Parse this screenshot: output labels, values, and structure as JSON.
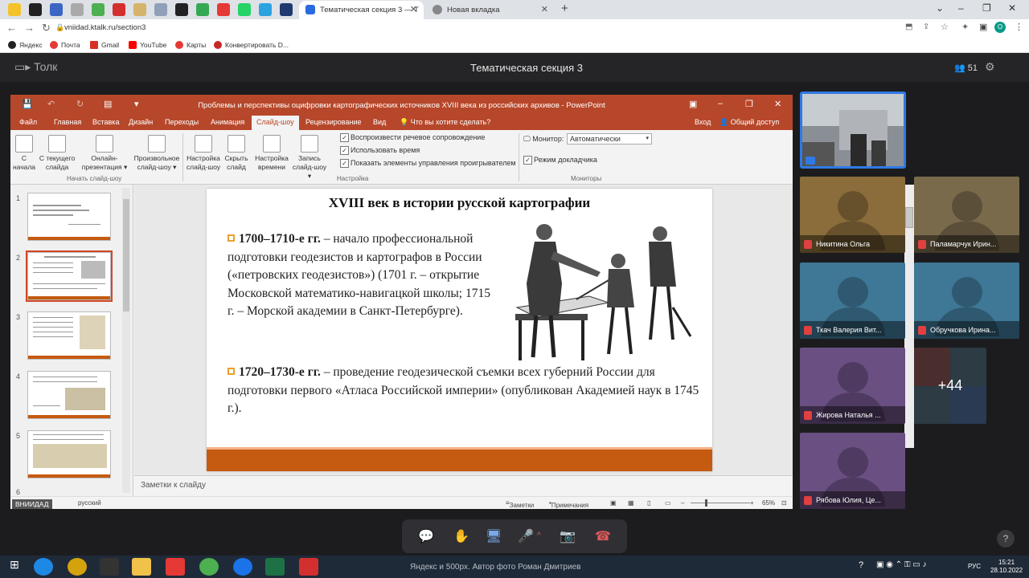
{
  "browser": {
    "tabs": [
      {
        "label": "Тематическая секция 3 — Т"
      },
      {
        "label": "Новая вкладка"
      }
    ],
    "url": "vniidad.ktalk.ru/section3",
    "bookmarks": [
      "Яндекс",
      "Почта",
      "Gmail",
      "YouTube",
      "Карты",
      "Конвертировать D..."
    ]
  },
  "tolk": {
    "logo": "Толк",
    "title": "Тематическая секция 3",
    "participants": "51"
  },
  "powerpoint": {
    "title": "Проблемы и перспективы оцифровки картографических источников XVIII века из российских архивов - PowerPoint",
    "tabs": [
      "Файл",
      "Главная",
      "Вставка",
      "Дизайн",
      "Переходы",
      "Анимация",
      "Слайд-шоу",
      "Рецензирование",
      "Вид",
      "Что вы хотите сделать?"
    ],
    "login": "Вход",
    "share": "Общий доступ",
    "ribbon": {
      "from_start": [
        "С",
        "начала"
      ],
      "from_current": [
        "С текущего",
        "слайда"
      ],
      "online": [
        "Онлайн-",
        "презентация"
      ],
      "custom": [
        "Произвольное",
        "слайд-шоу"
      ],
      "group_start": "Начать слайд-шоу",
      "setup": [
        "Настройка",
        "слайд-шоу"
      ],
      "hide": [
        "Скрыть",
        "слайд"
      ],
      "rehearse": [
        "Настройка",
        "времени"
      ],
      "record": [
        "Запись",
        "слайд-шоу"
      ],
      "cb1": "Воспроизвести речевое сопровождение",
      "cb2": "Использовать время",
      "cb3": "Показать элементы управления проигрывателем",
      "group_setup": "Настройка",
      "monitor_label": "Монитор:",
      "monitor_value": "Автоматически",
      "presenter": "Режим докладчика",
      "group_monitors": "Мониторы"
    },
    "thumbs": [
      "1",
      "2",
      "3",
      "4",
      "5",
      "6"
    ],
    "slide": {
      "title": "XVIII век в истории русской картографии",
      "b1_head": "1700–1710-е гг.",
      "b1_text": " – начало профессиональной подготовки геодезистов и картографов в России («петровских геодезистов»)  (1701 г. – открытие Московской математико-навигацкой школы; 1715 г. – Морской академии в Санкт-Петербурге).",
      "b2_head": "1720–1730-е гг.",
      "b2_text": " – проведение геодезической съемки всех губерний России для подготовки первого «Атласа Российской империи» (опубликован Академией наук в 1745 г.)."
    },
    "notes": "Заметки к слайду",
    "status": {
      "lang": "русский",
      "notes": "Заметки",
      "comments": "Примечания",
      "zoom": "65%",
      "tag": "ВНИИДАД"
    }
  },
  "participants": [
    {
      "name": "Никитина Ольга",
      "color": "#8a6d3b"
    },
    {
      "name": "Паламарчук Ирин...",
      "color": "#7a6a4c"
    },
    {
      "name": "Ткач Валерия Вит...",
      "color": "#3f7796"
    },
    {
      "name": "Обручкова Ирина...",
      "color": "#3f7796"
    },
    {
      "name": "Жирова Наталья ...",
      "color": "#6a4f82"
    },
    {
      "name": "Рябова Юлия, Це...",
      "color": "#6a4f82"
    }
  ],
  "more": "+44",
  "taskbar": {
    "info": "Яндекс и 500px. Автор фото Роман Дмитриев",
    "time": "15:21",
    "date": "28.10.2022",
    "lang": "РУС"
  }
}
